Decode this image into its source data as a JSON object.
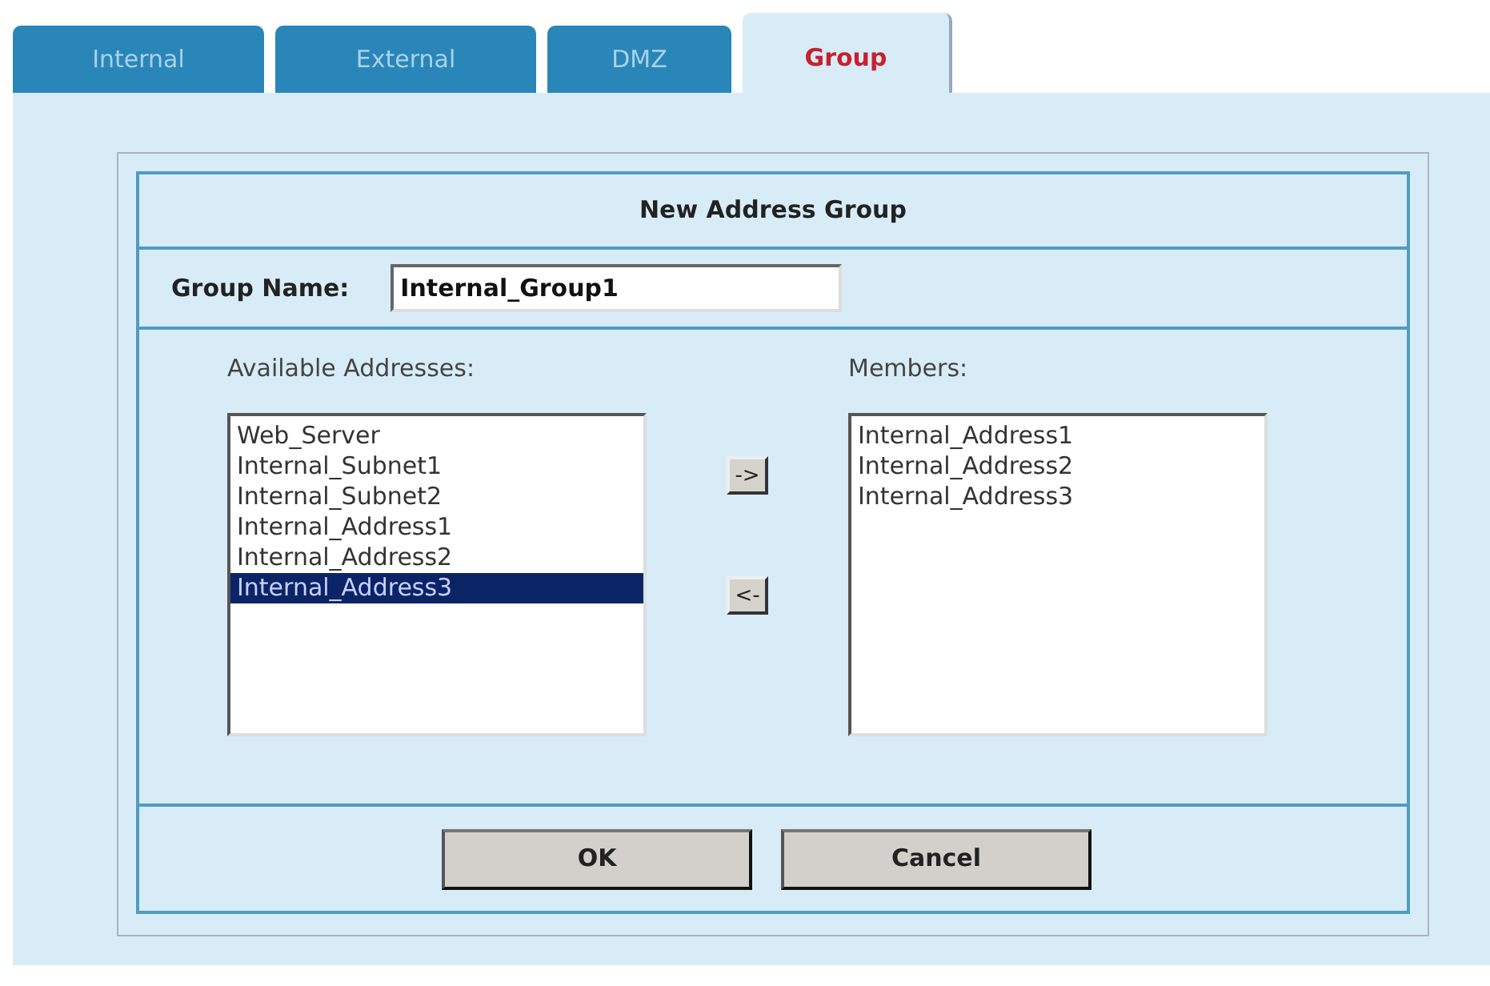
{
  "tabs": [
    {
      "label": "Internal",
      "selected": false
    },
    {
      "label": "External",
      "selected": false
    },
    {
      "label": "DMZ",
      "selected": false
    },
    {
      "label": "Group",
      "selected": true
    }
  ],
  "dialog": {
    "title": "New Address Group",
    "group_name": {
      "label": "Group Name:",
      "value": "Internal_Group1"
    },
    "available": {
      "label": "Available Addresses:",
      "items": [
        {
          "text": "Web_Server",
          "selected": false
        },
        {
          "text": "Internal_Subnet1",
          "selected": false
        },
        {
          "text": "Internal_Subnet2",
          "selected": false
        },
        {
          "text": "Internal_Address1",
          "selected": false
        },
        {
          "text": "Internal_Address2",
          "selected": false
        },
        {
          "text": "Internal_Address3",
          "selected": true
        }
      ]
    },
    "move_buttons": [
      "->",
      "<-"
    ],
    "members": {
      "label": "Members:",
      "items": [
        {
          "text": "Internal_Address1",
          "selected": false
        },
        {
          "text": "Internal_Address2",
          "selected": false
        },
        {
          "text": "Internal_Address3",
          "selected": false
        }
      ]
    },
    "buttons": [
      "OK",
      "Cancel"
    ]
  }
}
